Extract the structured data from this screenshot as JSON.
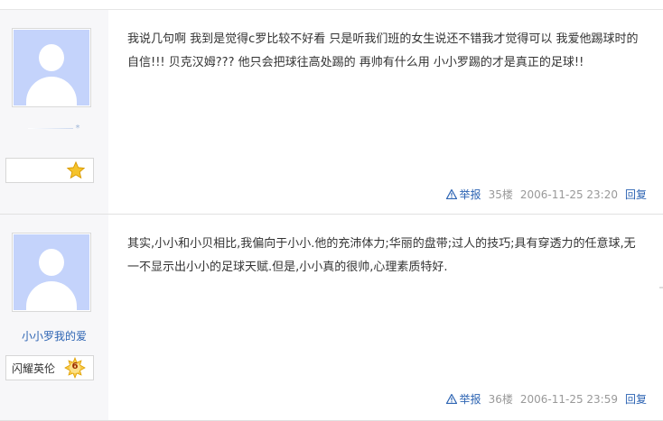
{
  "posts": [
    {
      "username": "*",
      "badge_label": "",
      "badge_level": "",
      "content": "我说几句啊 我到是觉得c罗比较不好看 只是听我们班的女生说还不错我才觉得可以 我爱他踢球时的自信!!! 贝克汉姆??? 他只会把球往高处踢的 再帅有什么用 小小罗踢的才是真正的足球!!",
      "report_label": "举报",
      "floor": "35楼",
      "time": "2006-11-25 23:20",
      "reply_label": "回复"
    },
    {
      "username": "小小罗我的爱",
      "badge_label": "闪耀英伦",
      "badge_level": "6",
      "content": "其实,小小和小贝相比,我偏向于小小.他的充沛体力;华丽的盘带;过人的技巧;具有穿透力的任意球,无一不显示出小小的足球天赋.但是,小小真的很帅,心理素质特好.",
      "report_label": "举报",
      "floor": "36楼",
      "time": "2006-11-25 23:59",
      "reply_label": "回复"
    }
  ],
  "icons": {
    "star": "star-icon",
    "level": "level-badge-icon",
    "warning": "warning-icon"
  },
  "colors": {
    "sidebar_bg": "#f7f7f9",
    "link": "#2d64b3",
    "meta": "#999999",
    "avatar_bg": "#c4d3fb",
    "star": "#f5b800"
  }
}
